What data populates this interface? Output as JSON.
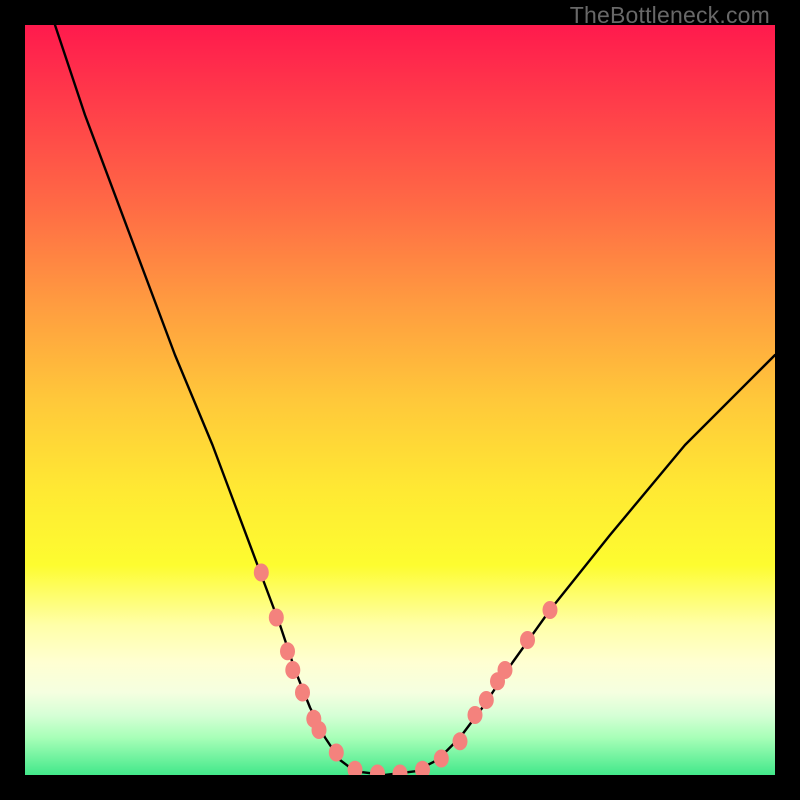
{
  "watermark": "TheBottleneck.com",
  "chart_data": {
    "type": "line",
    "title": "",
    "xlabel": "",
    "ylabel": "",
    "xlim": [
      0,
      100
    ],
    "ylim": [
      0,
      100
    ],
    "series": [
      {
        "name": "bottleneck-curve",
        "x": [
          4,
          8,
          14,
          20,
          25,
          28,
          31,
          34,
          36,
          38,
          40,
          42,
          44,
          48,
          52,
          55,
          58,
          61,
          65,
          70,
          78,
          88,
          100
        ],
        "y": [
          100,
          88,
          72,
          56,
          44,
          36,
          28,
          20,
          14,
          9,
          5,
          2,
          0.5,
          0,
          0.5,
          2,
          5,
          9,
          15,
          22,
          32,
          44,
          56
        ]
      }
    ],
    "markers": {
      "name": "highlight-dots",
      "color": "#f4827d",
      "points": [
        {
          "x": 31.5,
          "y": 27
        },
        {
          "x": 33.5,
          "y": 21
        },
        {
          "x": 35,
          "y": 16.5
        },
        {
          "x": 35.7,
          "y": 14
        },
        {
          "x": 37,
          "y": 11
        },
        {
          "x": 38.5,
          "y": 7.5
        },
        {
          "x": 39.2,
          "y": 6
        },
        {
          "x": 41.5,
          "y": 3
        },
        {
          "x": 44,
          "y": 0.7
        },
        {
          "x": 47,
          "y": 0.2
        },
        {
          "x": 50,
          "y": 0.2
        },
        {
          "x": 53,
          "y": 0.7
        },
        {
          "x": 55.5,
          "y": 2.2
        },
        {
          "x": 58,
          "y": 4.5
        },
        {
          "x": 60,
          "y": 8
        },
        {
          "x": 61.5,
          "y": 10
        },
        {
          "x": 63,
          "y": 12.5
        },
        {
          "x": 64,
          "y": 14
        },
        {
          "x": 67,
          "y": 18
        },
        {
          "x": 70,
          "y": 22
        }
      ]
    },
    "background_gradient": {
      "top": "#ff1a4d",
      "mid": "#ffe933",
      "bottom": "#42e88a"
    }
  }
}
